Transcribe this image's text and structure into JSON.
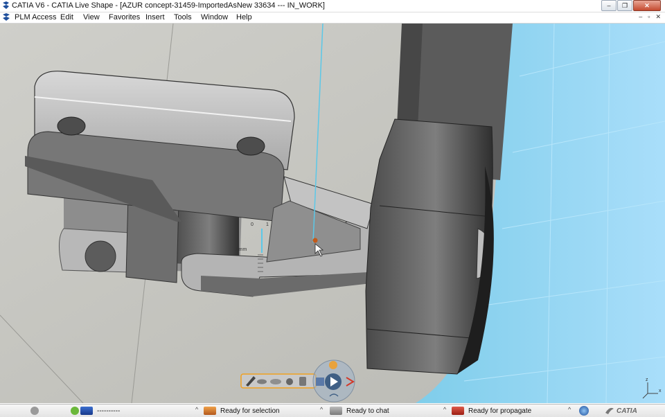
{
  "window": {
    "title": "CATIA V6 - CATIA Live Shape - [AZUR concept-31459-ImportedAsNew 33634 --- IN_WORK]",
    "min_glyph": "–",
    "max_glyph": "❐",
    "close_glyph": "✕"
  },
  "menu": {
    "items": [
      "PLM Access",
      "Edit",
      "View",
      "Favorites",
      "Insert",
      "Tools",
      "Window",
      "Help"
    ],
    "doc_controls": [
      "–",
      "▫",
      "✕"
    ]
  },
  "viewport": {
    "ruler_labels": [
      "0",
      "1",
      "Amm"
    ],
    "compass_axes": [
      "z",
      "x"
    ]
  },
  "statusbar": {
    "field_1": "----------",
    "selection_status": "Ready for selection",
    "chat_status": "Ready to chat",
    "propagate_status": "Ready for propagate",
    "brand": "CATIA"
  },
  "colors": {
    "part_gray": "#8a8a8a",
    "background_gray": "#c8c8c2",
    "floor_blue": "#8ed2ee",
    "axis_cyan": "#5bc8e8"
  }
}
